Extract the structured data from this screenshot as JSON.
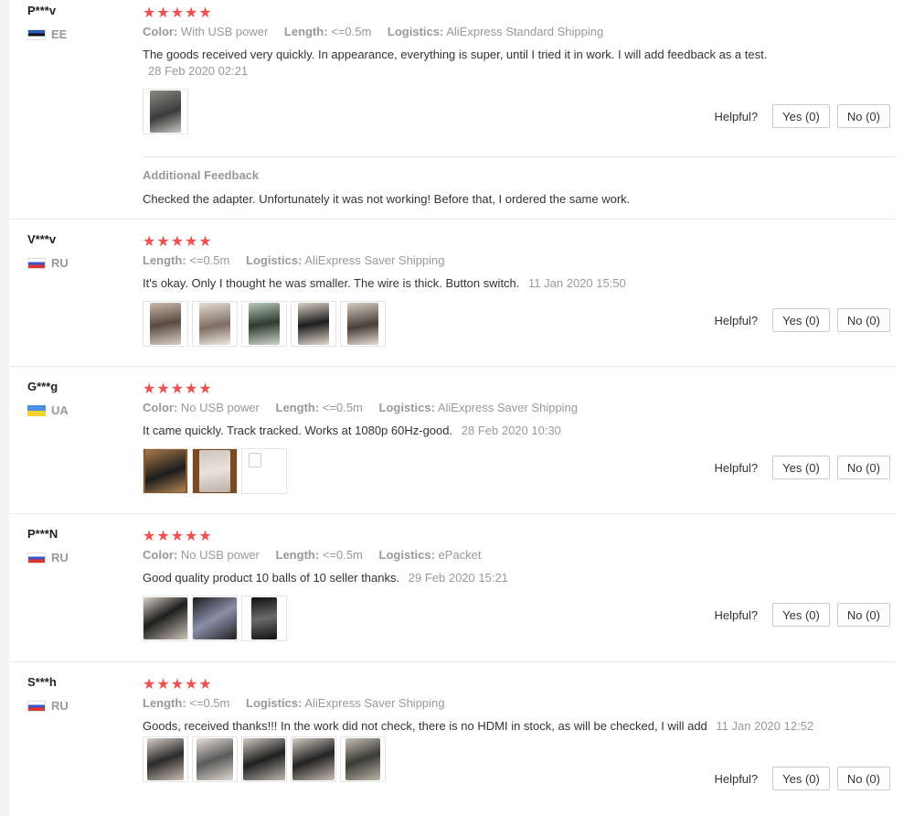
{
  "helpful_label": "Helpful?",
  "reviews": [
    {
      "user": "P***v",
      "country": "EE",
      "stars": "★★★★★",
      "attrs": [
        {
          "k": "Color:",
          "v": "With USB power"
        },
        {
          "k": "Length:",
          "v": "<=0.5m"
        },
        {
          "k": "Logistics:",
          "v": "AliExpress Standard Shipping"
        }
      ],
      "text": "The goods received very quickly. In appearance, everything is super, until I tried it in work. I will add feedback as a test.",
      "date": "28 Feb 2020 02:21",
      "yes": "Yes (0)",
      "no": "No (0)",
      "additional": {
        "title": "Additional Feedback",
        "text": "Checked the adapter. Unfortunately it was not working! Before that, I ordered the same work."
      }
    },
    {
      "user": "V***v",
      "country": "RU",
      "stars": "★★★★★",
      "attrs": [
        {
          "k": "Length:",
          "v": "<=0.5m"
        },
        {
          "k": "Logistics:",
          "v": "AliExpress Saver Shipping"
        }
      ],
      "text": "It's okay. Only I thought he was smaller. The wire is thick. Button switch.",
      "date": "11 Jan 2020 15:50",
      "yes": "Yes (0)",
      "no": "No (0)"
    },
    {
      "user": "G***g",
      "country": "UA",
      "stars": "★★★★★",
      "attrs": [
        {
          "k": "Color:",
          "v": "No USB power"
        },
        {
          "k": "Length:",
          "v": "<=0.5m"
        },
        {
          "k": "Logistics:",
          "v": "AliExpress Saver Shipping"
        }
      ],
      "text": "It came quickly. Track tracked. Works at 1080p 60Hz-good.",
      "date": "28 Feb 2020 10:30",
      "yes": "Yes (0)",
      "no": "No (0)"
    },
    {
      "user": "P***N",
      "country": "RU",
      "stars": "★★★★★",
      "attrs": [
        {
          "k": "Color:",
          "v": "No USB power"
        },
        {
          "k": "Length:",
          "v": "<=0.5m"
        },
        {
          "k": "Logistics:",
          "v": "ePacket"
        }
      ],
      "text": "Good quality product 10 balls of 10 seller thanks.",
      "date": "29 Feb 2020 15:21",
      "yes": "Yes (0)",
      "no": "No (0)"
    },
    {
      "user": "S***h",
      "country": "RU",
      "stars": "★★★★★",
      "attrs": [
        {
          "k": "Length:",
          "v": "<=0.5m"
        },
        {
          "k": "Logistics:",
          "v": "AliExpress Saver Shipping"
        }
      ],
      "text": "Goods, received thanks!!! In the work did not check, there is no HDMI in stock, as will be checked, I will add",
      "date": "11 Jan 2020 12:52",
      "yes": "Yes (0)",
      "no": "No (0)"
    }
  ]
}
